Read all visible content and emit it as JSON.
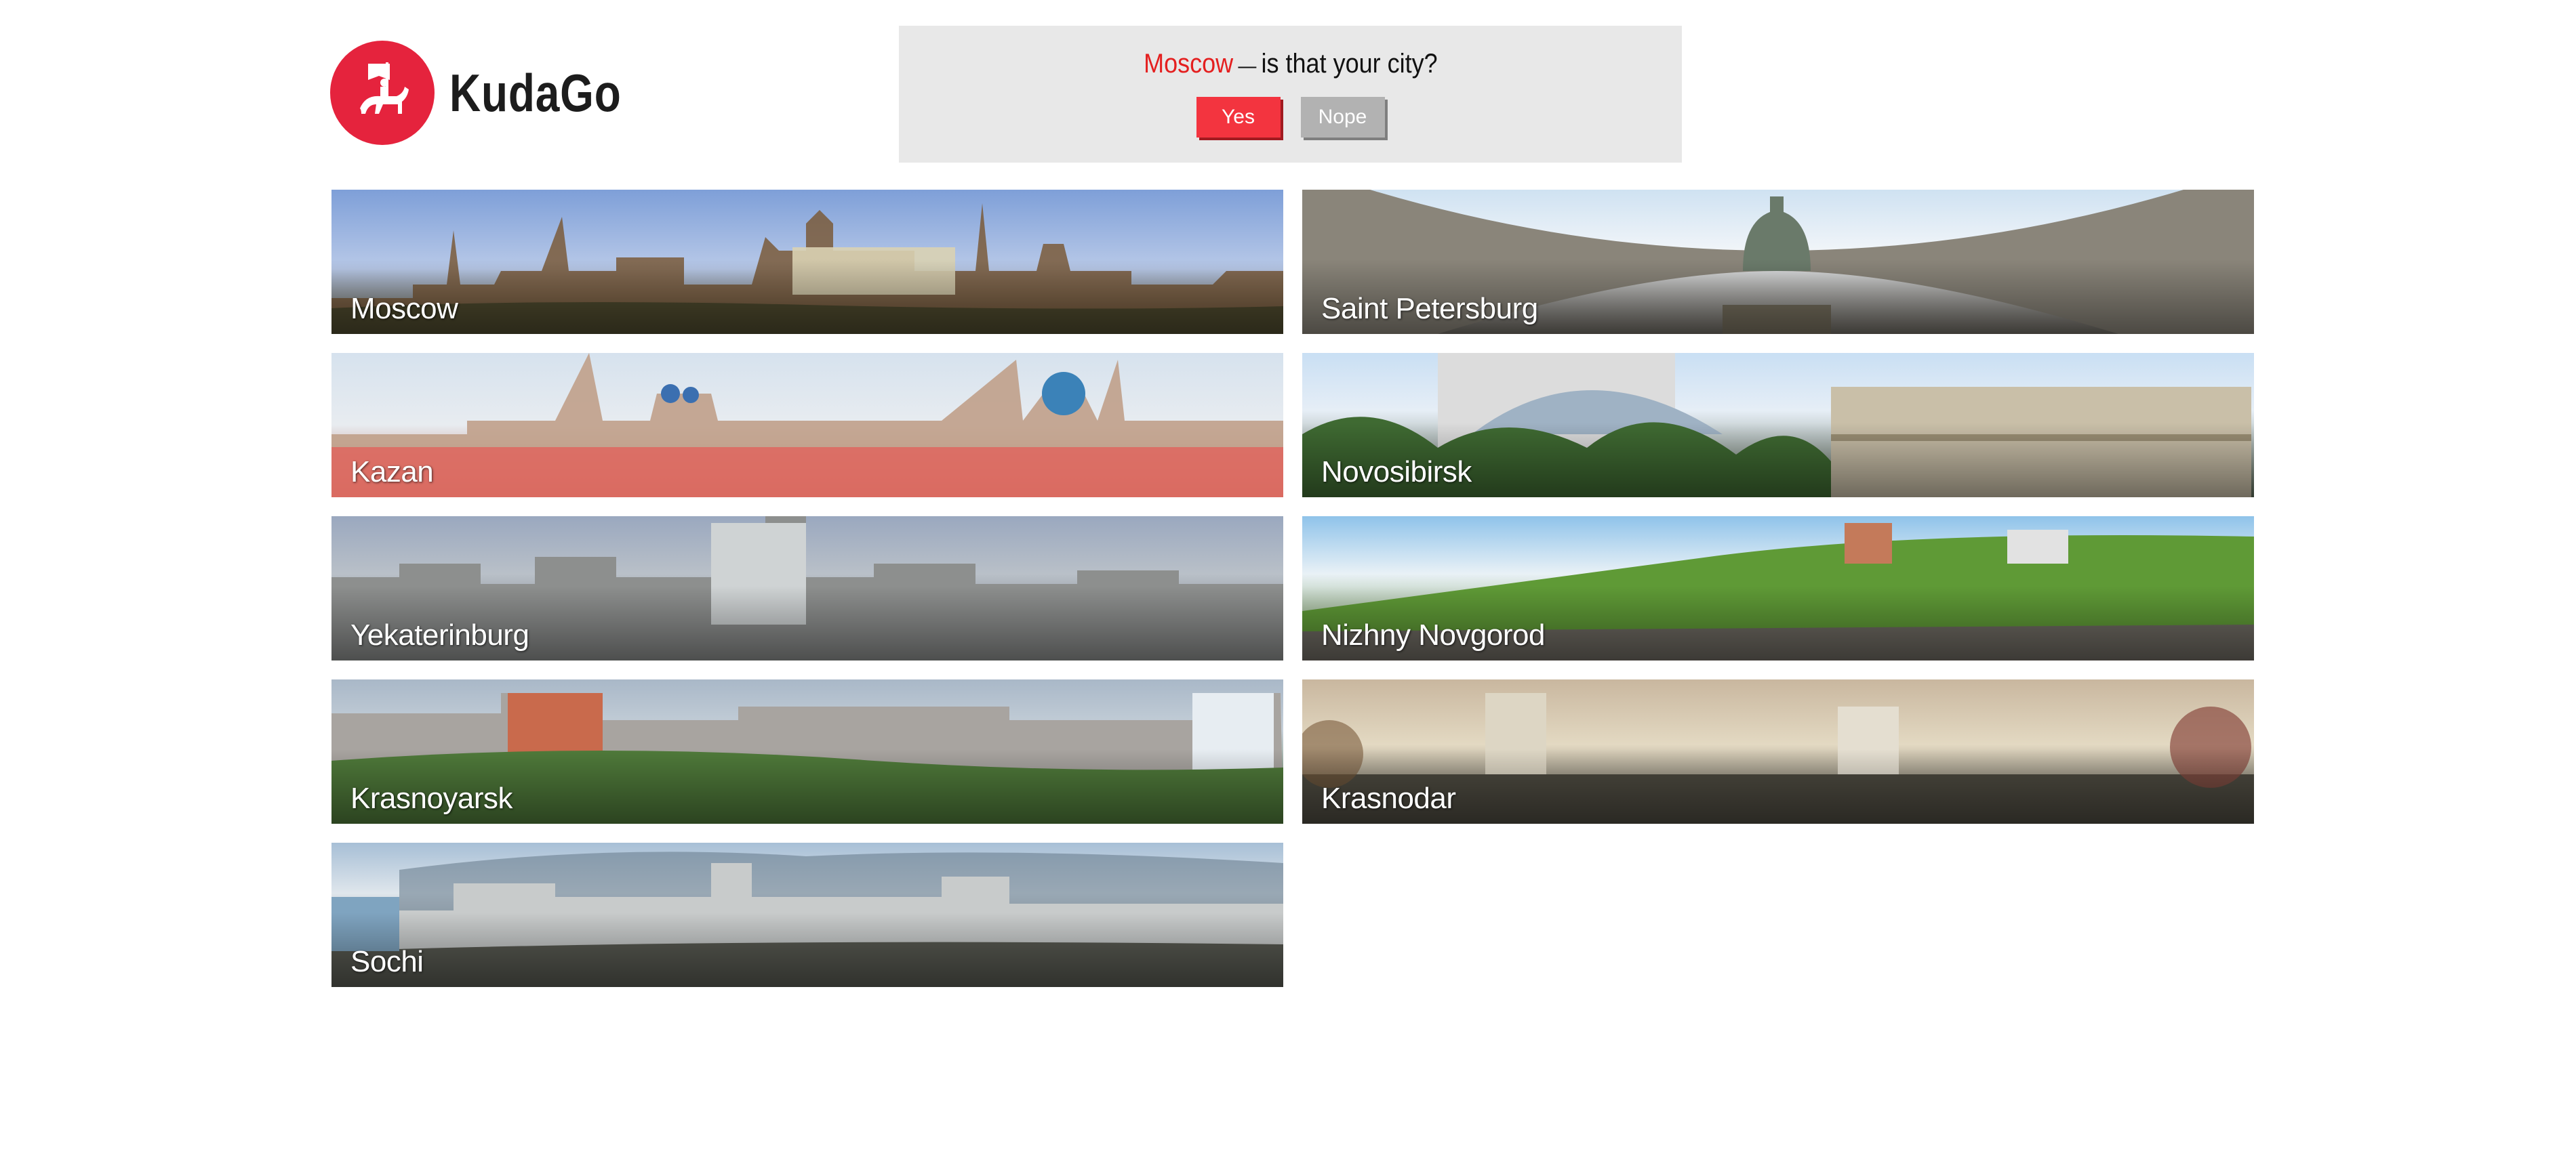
{
  "brand": {
    "logo_text": "KudaGo",
    "accent_color": "#e5233d",
    "logo_icon": "horse-rider-flag-icon"
  },
  "city_prompt": {
    "city": "Moscow",
    "dash": "—",
    "question": "is that your city?",
    "yes_label": "Yes",
    "no_label": "Nope"
  },
  "cities": [
    {
      "name": "Moscow"
    },
    {
      "name": "Saint Petersburg"
    },
    {
      "name": "Kazan"
    },
    {
      "name": "Novosibirsk"
    },
    {
      "name": "Yekaterinburg"
    },
    {
      "name": "Nizhny Novgorod"
    },
    {
      "name": "Krasnoyarsk"
    },
    {
      "name": "Krasnodar"
    },
    {
      "name": "Sochi"
    }
  ]
}
